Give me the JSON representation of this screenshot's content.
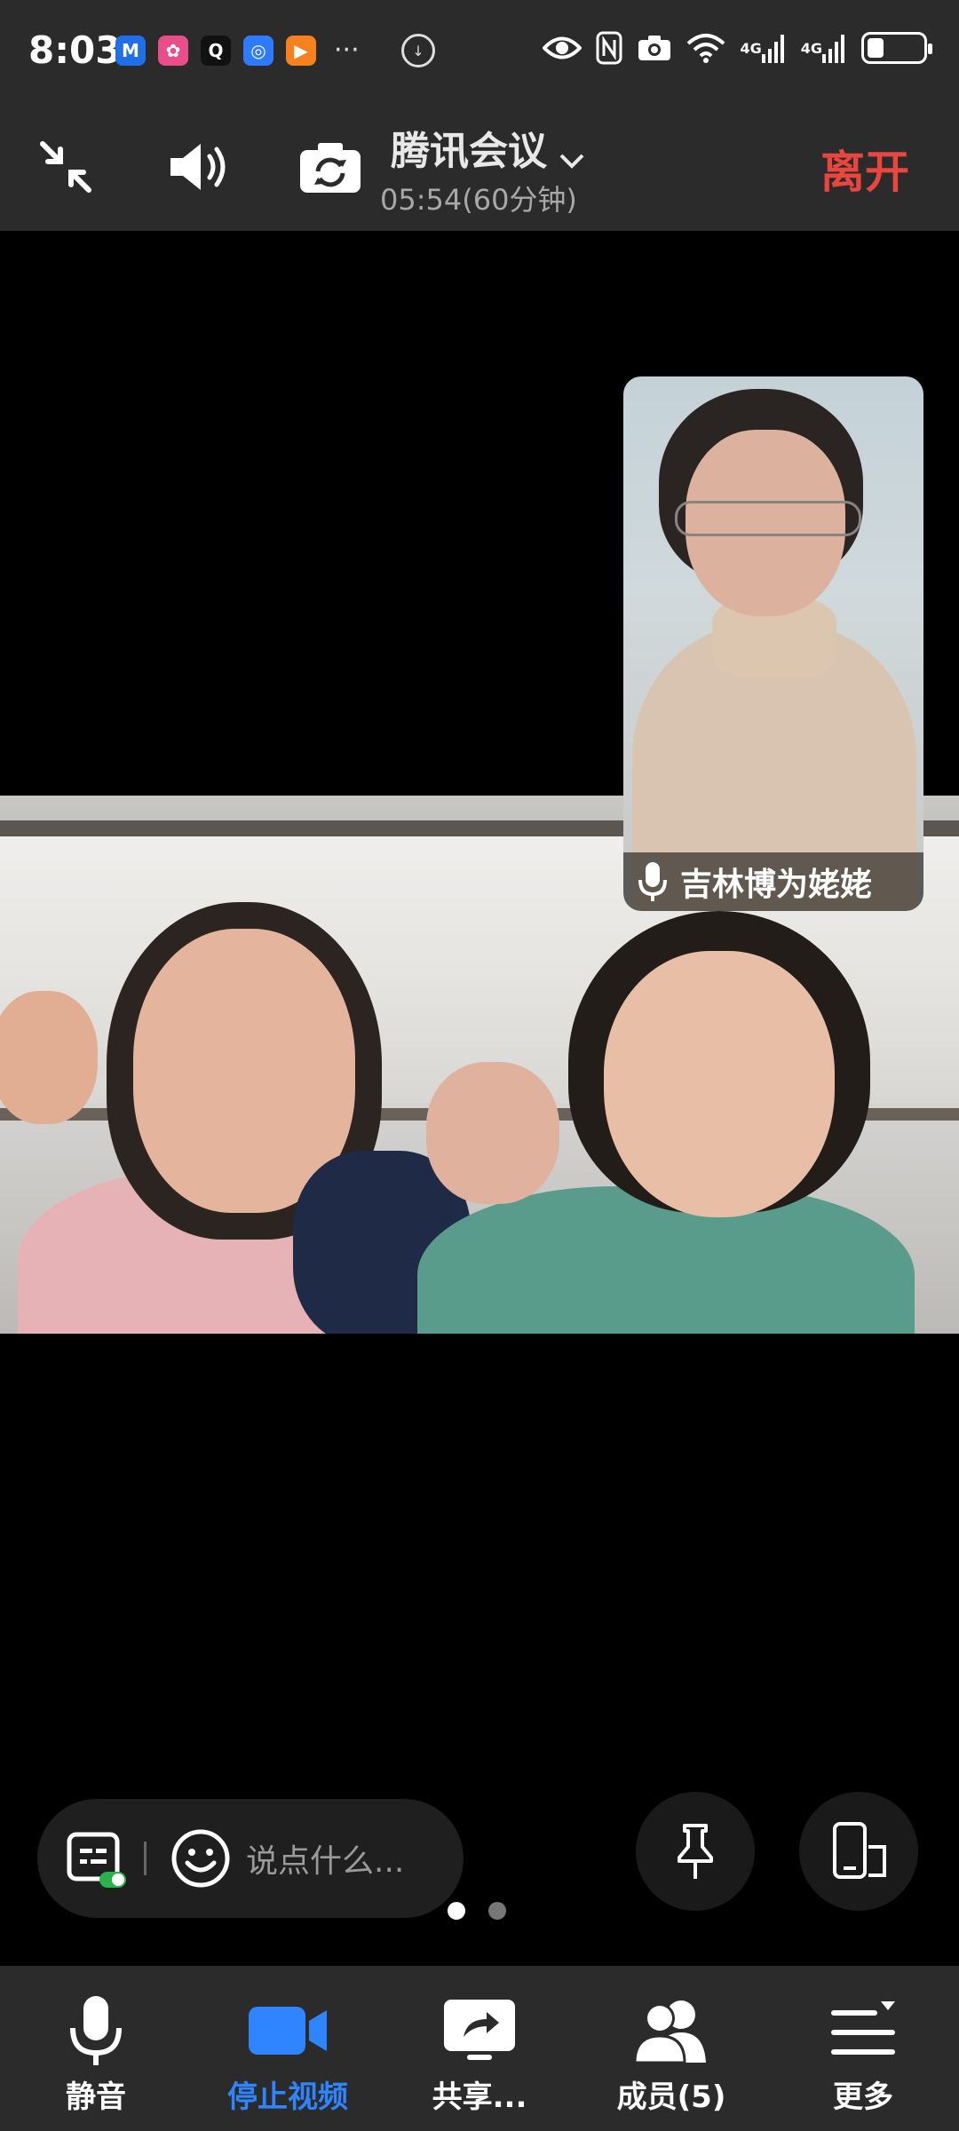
{
  "status_bar": {
    "time": "8:03",
    "apps": [
      {
        "icon": "app-icon-1",
        "color": "#1f6fe8",
        "glyph": "M"
      },
      {
        "icon": "app-icon-2",
        "color": "#e84f8a",
        "glyph": "✿"
      },
      {
        "icon": "qq-icon",
        "color": "#111111",
        "glyph": "Q"
      },
      {
        "icon": "app-icon-4",
        "color": "#2f7bff",
        "glyph": "◎"
      },
      {
        "icon": "app-icon-5",
        "color": "#f5821f",
        "glyph": "▶"
      }
    ],
    "more": "···",
    "network_1": "4G",
    "network_2": "4G",
    "battery_level": 0.3
  },
  "header": {
    "title": "腾讯会议",
    "timer": "05:54(60分钟)",
    "leave_label": "离开"
  },
  "thumbnail": {
    "name": "吉林博为姥姥"
  },
  "chat": {
    "placeholder": "说点什么..."
  },
  "pager": {
    "pages": 2,
    "active": 0
  },
  "toolbar": {
    "items": [
      {
        "label": "静音",
        "icon": "microphone-icon"
      },
      {
        "label": "停止视频",
        "icon": "video-camera-icon"
      },
      {
        "label": "共享...",
        "icon": "share-screen-icon"
      },
      {
        "label": "成员(5)",
        "icon": "members-icon"
      },
      {
        "label": "更多",
        "icon": "more-menu-icon"
      }
    ]
  },
  "colors": {
    "accent_blue": "#2f85ff",
    "leave_red": "#e8463e",
    "bar_bg": "#2b2b2b"
  }
}
